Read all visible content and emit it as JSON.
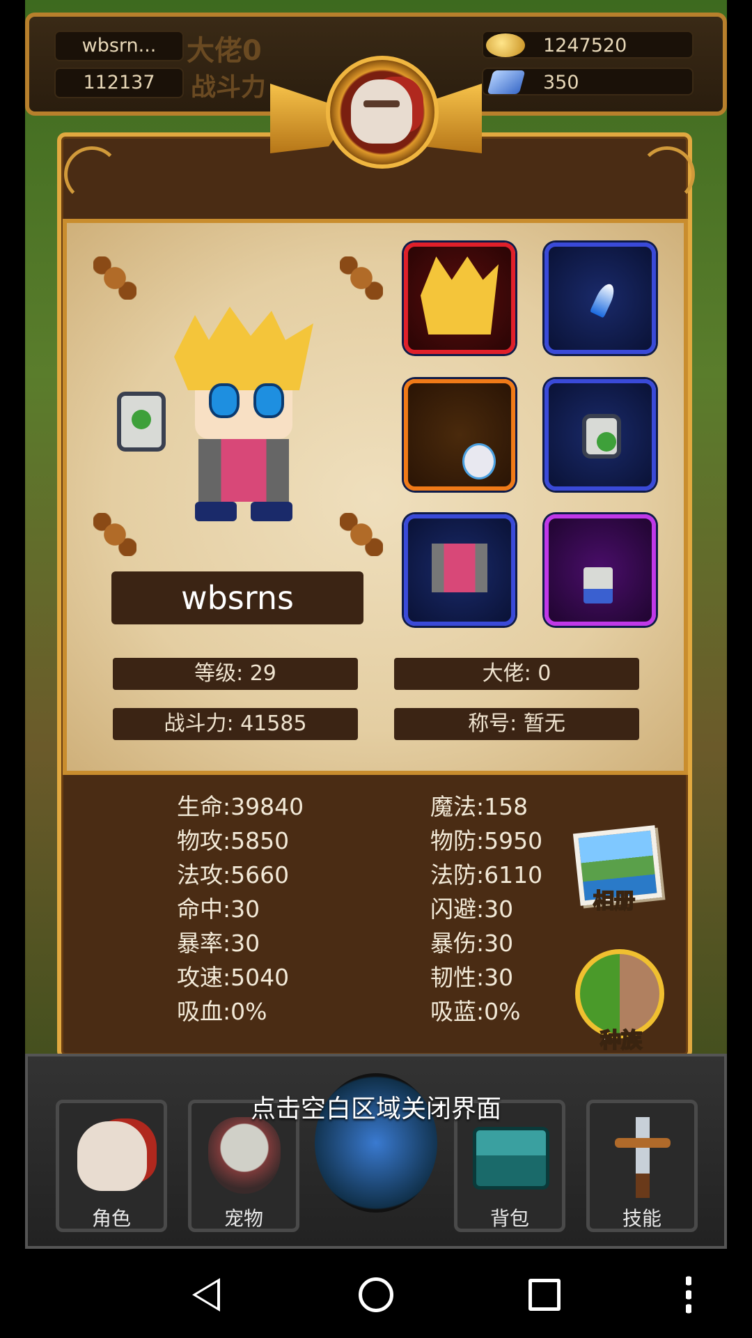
{
  "hud": {
    "player_name": "wbsrn...",
    "player_power": "112137",
    "boss_label": "大佬0",
    "power_label": "战斗力",
    "gold": "1247520",
    "gems": "350"
  },
  "profile": {
    "name": "wbsrns",
    "level": "等级: 29",
    "boss": "大佬: 0",
    "power": "战斗力: 41585",
    "title": "称号: 暂无"
  },
  "stats": {
    "left": [
      "生命:39840",
      "物攻:5850",
      "法攻:5660",
      "命中:30",
      "暴率:30",
      "攻速:5040",
      "吸血:0%"
    ],
    "right": [
      "魔法:158",
      "物防:5950",
      "法防:6110",
      "闪避:30",
      "暴伤:30",
      "韧性:30",
      "吸蓝:0%"
    ]
  },
  "side_buttons": {
    "album": "相册",
    "race": "种族"
  },
  "hint": "点击空白区域关闭界面",
  "bottom_nav": {
    "role": "角色",
    "pet": "宠物",
    "bag": "背包",
    "skill": "技能"
  },
  "colors": {
    "gold_border": "#e2a940",
    "panel_brown": "#4a2c14",
    "slot_blue": "#3a4ad8",
    "slot_red": "#e0202a",
    "slot_orange": "#f07a18",
    "slot_purple": "#c038e8"
  }
}
